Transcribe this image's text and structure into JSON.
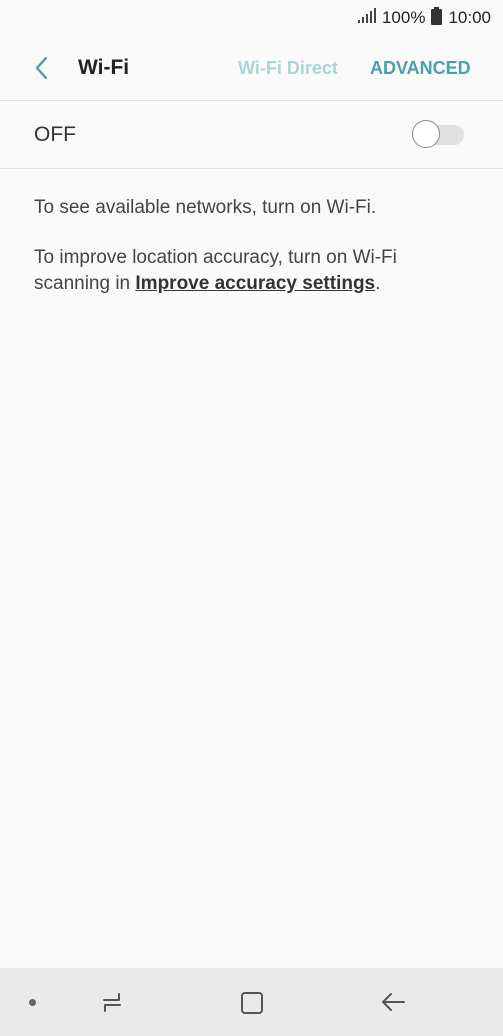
{
  "status_bar": {
    "battery": "100%",
    "time": "10:00"
  },
  "header": {
    "title": "Wi-Fi",
    "wifi_direct_label": "Wi-Fi Direct",
    "advanced_label": "ADVANCED"
  },
  "wifi_toggle": {
    "label": "OFF",
    "state": "off"
  },
  "info": {
    "line1": "To see available networks, turn on Wi-Fi.",
    "line2_prefix": "To improve location accuracy, turn on Wi-Fi scanning in ",
    "line2_link": "Improve accuracy settings",
    "line2_suffix": "."
  },
  "colors": {
    "accent": "#4b9fb2",
    "accent_disabled": "#a9d3dd",
    "background": "#fafafa",
    "nav_bar": "#eaeaea"
  },
  "icons": {
    "back": "chevron-left-icon",
    "signal": "signal-icon",
    "battery": "battery-icon",
    "nav_recent": "recent-apps-icon",
    "nav_home": "home-icon",
    "nav_back": "back-arrow-icon"
  }
}
